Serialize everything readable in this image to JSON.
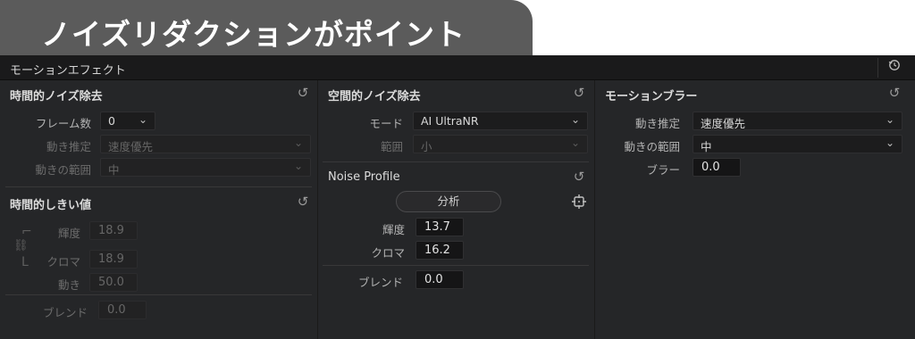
{
  "banner": {
    "title": "ノイズリダクションがポイント"
  },
  "header": {
    "title": "モーションエフェクト",
    "reset_icon": "history-reset-icon"
  },
  "temporal_nr": {
    "title": "時間的ノイズ除去",
    "frames_label": "フレーム数",
    "frames_value": "0",
    "motion_est_label": "動き推定",
    "motion_est_value": "速度優先",
    "motion_range_label": "動きの範囲",
    "motion_range_value": "中"
  },
  "temporal_threshold": {
    "title": "時間的しきい値",
    "luma_label": "輝度",
    "luma_value": "18.9",
    "chroma_label": "クロマ",
    "chroma_value": "18.9",
    "motion_label": "動き",
    "motion_value": "50.0",
    "blend_label": "ブレンド",
    "blend_value": "0.0"
  },
  "spatial_nr": {
    "title": "空間的ノイズ除去",
    "mode_label": "モード",
    "mode_value": "AI UltraNR",
    "range_label": "範囲",
    "range_value": "小"
  },
  "noise_profile": {
    "title": "Noise Profile",
    "analyze_label": "分析",
    "luma_label": "輝度",
    "luma_value": "13.7",
    "chroma_label": "クロマ",
    "chroma_value": "16.2",
    "blend_label": "ブレンド",
    "blend_value": "0.0"
  },
  "motion_blur": {
    "title": "モーションブラー",
    "motion_est_label": "動き推定",
    "motion_est_value": "速度優先",
    "motion_range_label": "動きの範囲",
    "motion_range_value": "中",
    "blur_label": "ブラー",
    "blur_value": "0.0"
  },
  "colors": {
    "panel_bg": "#252628",
    "header_bg": "#1a1a1b",
    "banner_bg": "#5b5b5b"
  }
}
